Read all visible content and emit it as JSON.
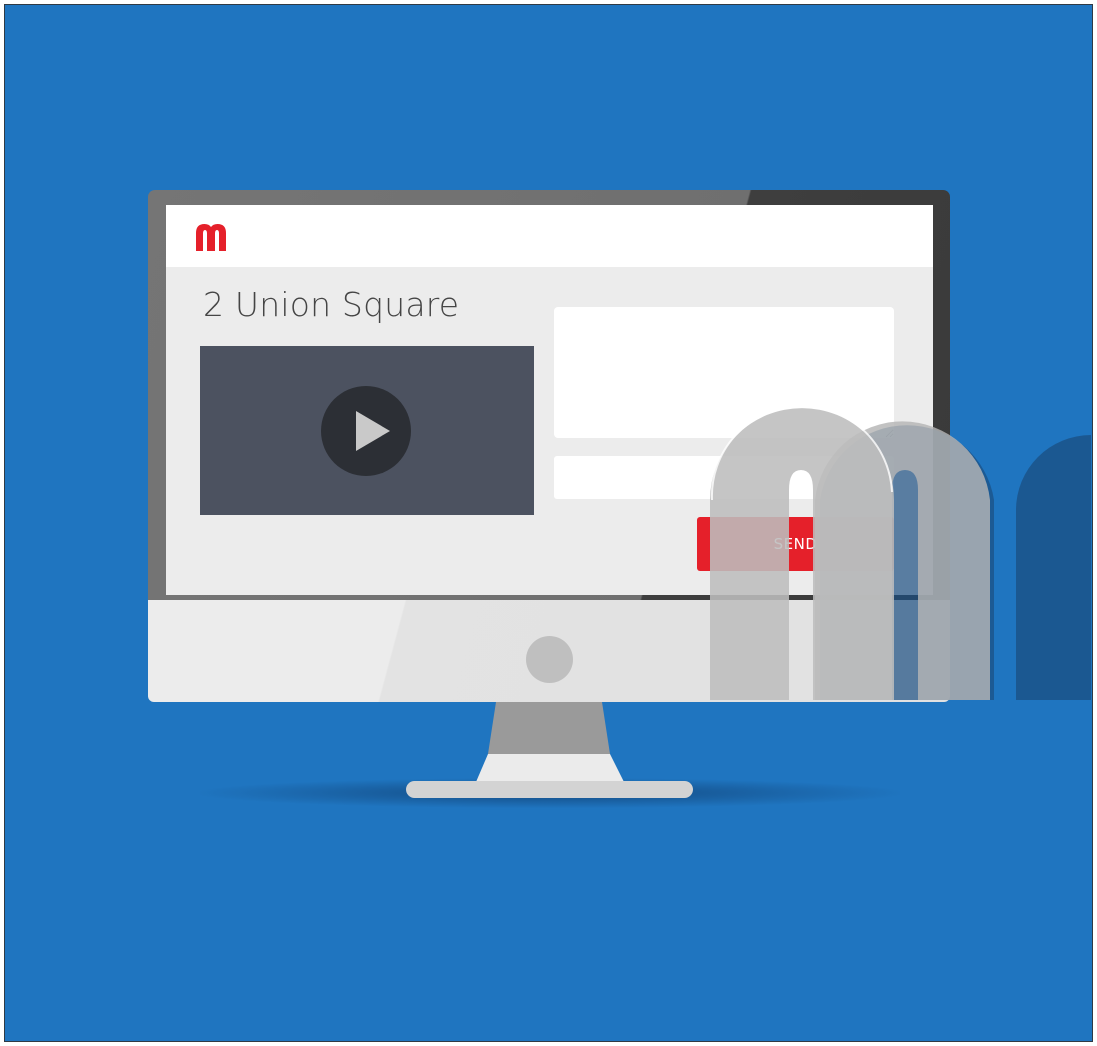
{
  "page": {
    "title": "2 Union Square"
  },
  "form": {
    "message_placeholder": "",
    "input_placeholder": "",
    "send_label": "SEND"
  },
  "icons": {
    "logo": "m-logo-icon",
    "play": "play-icon",
    "watermark": "m-logo-watermark"
  },
  "colors": {
    "background": "#1f75c0",
    "brand_red": "#e5202a",
    "video_bg": "#4c5260",
    "screen_bg": "#ececec"
  }
}
